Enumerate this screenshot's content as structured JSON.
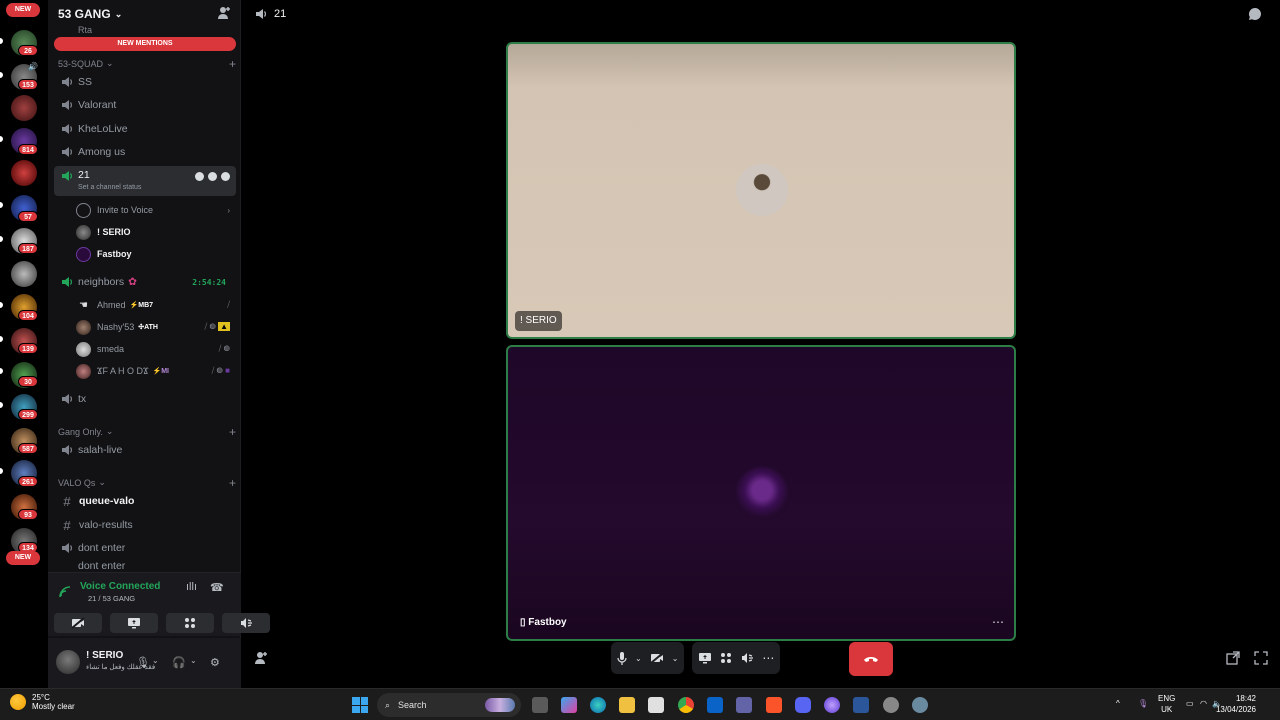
{
  "rail": {
    "new_top": "NEW",
    "badges": [
      "26",
      "153",
      "814",
      "57",
      "187",
      "104",
      "139",
      "30",
      "299",
      "587",
      "261",
      "93",
      "134"
    ],
    "new_bottom": "NEW"
  },
  "guild": {
    "name": "53 GANG",
    "new_mentions": "NEW MENTIONS",
    "cut_channel": "Rta"
  },
  "categories": {
    "squad": "53-SQUAD",
    "gang_only": "Gang Only.",
    "valo": "VALO Qs"
  },
  "channels": {
    "ss": "SS",
    "valorant": "Valorant",
    "khelolive": "KheLoLive",
    "among_us": "Among us",
    "active": "21",
    "active_status": "Set a channel status",
    "invite_to_voice": "Invite to Voice",
    "neighbors": "neighbors",
    "neighbors_timer": "2:54:24",
    "tx": "tx",
    "salah_live": "salah-live",
    "queue_valo": "queue-valo",
    "valo_results": "valo-results",
    "dont_enter": "dont enter",
    "dont_enter_cut": "dont enter"
  },
  "voice_users_21": [
    "! SERIO",
    "Fastboy"
  ],
  "voice_users_neighbors": [
    {
      "name": "Ahmed",
      "tag": "⚡MB7"
    },
    {
      "name": "Nashy'53",
      "tag": "✣ATH"
    },
    {
      "name": "smeda",
      "tag": ""
    },
    {
      "name": "ϪF A H O DϪ",
      "tag": "⚡MI"
    }
  ],
  "voice_panel": {
    "status": "Voice Connected",
    "location": "21 / 53 GANG"
  },
  "user_panel": {
    "name": "! SERIO",
    "status": "فقد عقلك وفعل ما تشاء"
  },
  "topbar": {
    "channel": "21"
  },
  "tiles": [
    {
      "name": "! SERIO"
    },
    {
      "name": "Fastboy"
    }
  ],
  "taskbar": {
    "temp": "25°C",
    "weather": "Mostly clear",
    "search_placeholder": "Search",
    "lang1": "ENG",
    "lang2": "UK",
    "time": "18:42",
    "date": "13/04/2026"
  },
  "colors": {
    "accent_green": "#23a55a",
    "danger_red": "#da373c",
    "tile_border": "#2d7d46"
  }
}
